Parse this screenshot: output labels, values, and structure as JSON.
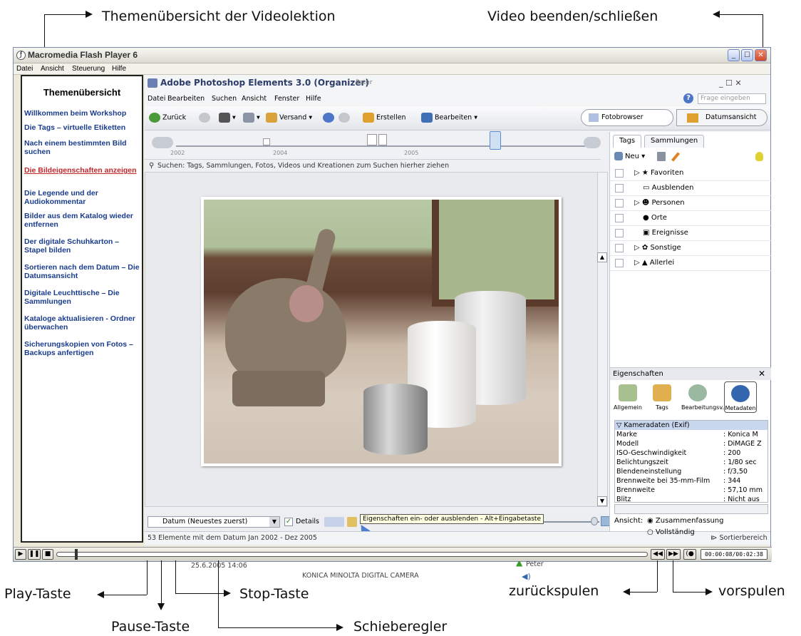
{
  "callouts": {
    "topics": "Themenübersicht der Videolektion",
    "close": "Video beenden/schließen",
    "play": "Play-Taste",
    "pause": "Pause-Taste",
    "stop": "Stop-Taste",
    "slider": "Schieberegler",
    "rewind": "zurückspulen",
    "forward": "vorspulen"
  },
  "flash": {
    "title": "Macromedia Flash Player 6",
    "menu": [
      "Datei",
      "Ansicht",
      "Steuerung",
      "Hilfe"
    ]
  },
  "sidebar": {
    "title": "Themenübersicht",
    "items": [
      "Willkommen beim Workshop",
      "Die Tags – virtuelle Etiketten",
      "Nach einem bestimmten Bild suchen",
      "Die Bildeigenschaften anzeigen",
      "Die Legende und der Audiokommentar",
      "Bilder aus dem Katalog wieder entfernen",
      "Der digitale Schuhkarton – Stapel bilden",
      "Sortieren nach dem Datum – Die Datumsansicht",
      "Digitale Leuchttische – Die Sammlungen",
      "Kataloge aktualisieren - Ordner überwachen",
      "Sicherungskopien von Fotos – Backups anfertigen"
    ],
    "active_index": 3
  },
  "pse": {
    "title": "Adobe Photoshop Elements 3.0 (Organizer)",
    "user": "Peter",
    "window_controls": "_ ☐ ✕",
    "menu": [
      "Datei",
      "Bearbeiten",
      "Suchen",
      "Ansicht",
      "Fenster",
      "Hilfe"
    ],
    "help_placeholder": "Frage eingeben",
    "toolbar": {
      "back": "Zurück",
      "send": "Versand",
      "create": "Erstellen",
      "edit": "Bearbeiten",
      "photo_browser": "Fotobrowser",
      "date_view": "Datumsansicht"
    },
    "timeline_years": [
      "2002",
      "2004",
      "2005"
    ],
    "search_hint": "Suchen: Tags, Sammlungen, Fotos, Videos und Kreationen zum Suchen hierher ziehen",
    "photo": {
      "date": "25.6.2005 14:06",
      "caption": "KONICA MINOLTA DIGITAL CAMERA",
      "tag": "Peter"
    },
    "sort_select": "Datum (Neuestes zuerst)",
    "details_label": "Details",
    "tooltip": "Eigenschaften ein- oder ausblenden - Alt+Eingabetaste",
    "status": "53 Elemente mit dem Datum Jan 2002 - Dez 2005",
    "sort_area": "Sortierbereich"
  },
  "tags_panel": {
    "tabs": [
      "Tags",
      "Sammlungen"
    ],
    "new_label": "Neu",
    "items": [
      "Favoriten",
      "Ausblenden",
      "Personen",
      "Orte",
      "Ereignisse",
      "Sonstige",
      "Allerlei"
    ]
  },
  "properties": {
    "title": "Eigenschaften",
    "tabs": [
      "Allgemein",
      "Tags",
      "Bearbeitungsv.",
      "Metadaten"
    ],
    "section": "Kameradaten (Exif)",
    "rows": [
      {
        "k": "Marke",
        "v": ": Konica M"
      },
      {
        "k": "Modell",
        "v": ": DiMAGE Z"
      },
      {
        "k": "ISO-Geschwindigkeit",
        "v": ": 200"
      },
      {
        "k": "Belichtungszeit",
        "v": ": 1/80 sec"
      },
      {
        "k": "Blendeneinstellung",
        "v": ": f/3,50"
      },
      {
        "k": "Brennweite bei 35-mm-Film",
        "v": ": 344"
      },
      {
        "k": "Brennweite",
        "v": ": 57,10 mm"
      },
      {
        "k": "Blitz",
        "v": ": Nicht aus"
      }
    ],
    "view_label": "Ansicht:",
    "view_summary": "Zusammenfassung",
    "view_full": "Vollständig"
  },
  "player": {
    "time": "00:00:08/00:02:38"
  }
}
